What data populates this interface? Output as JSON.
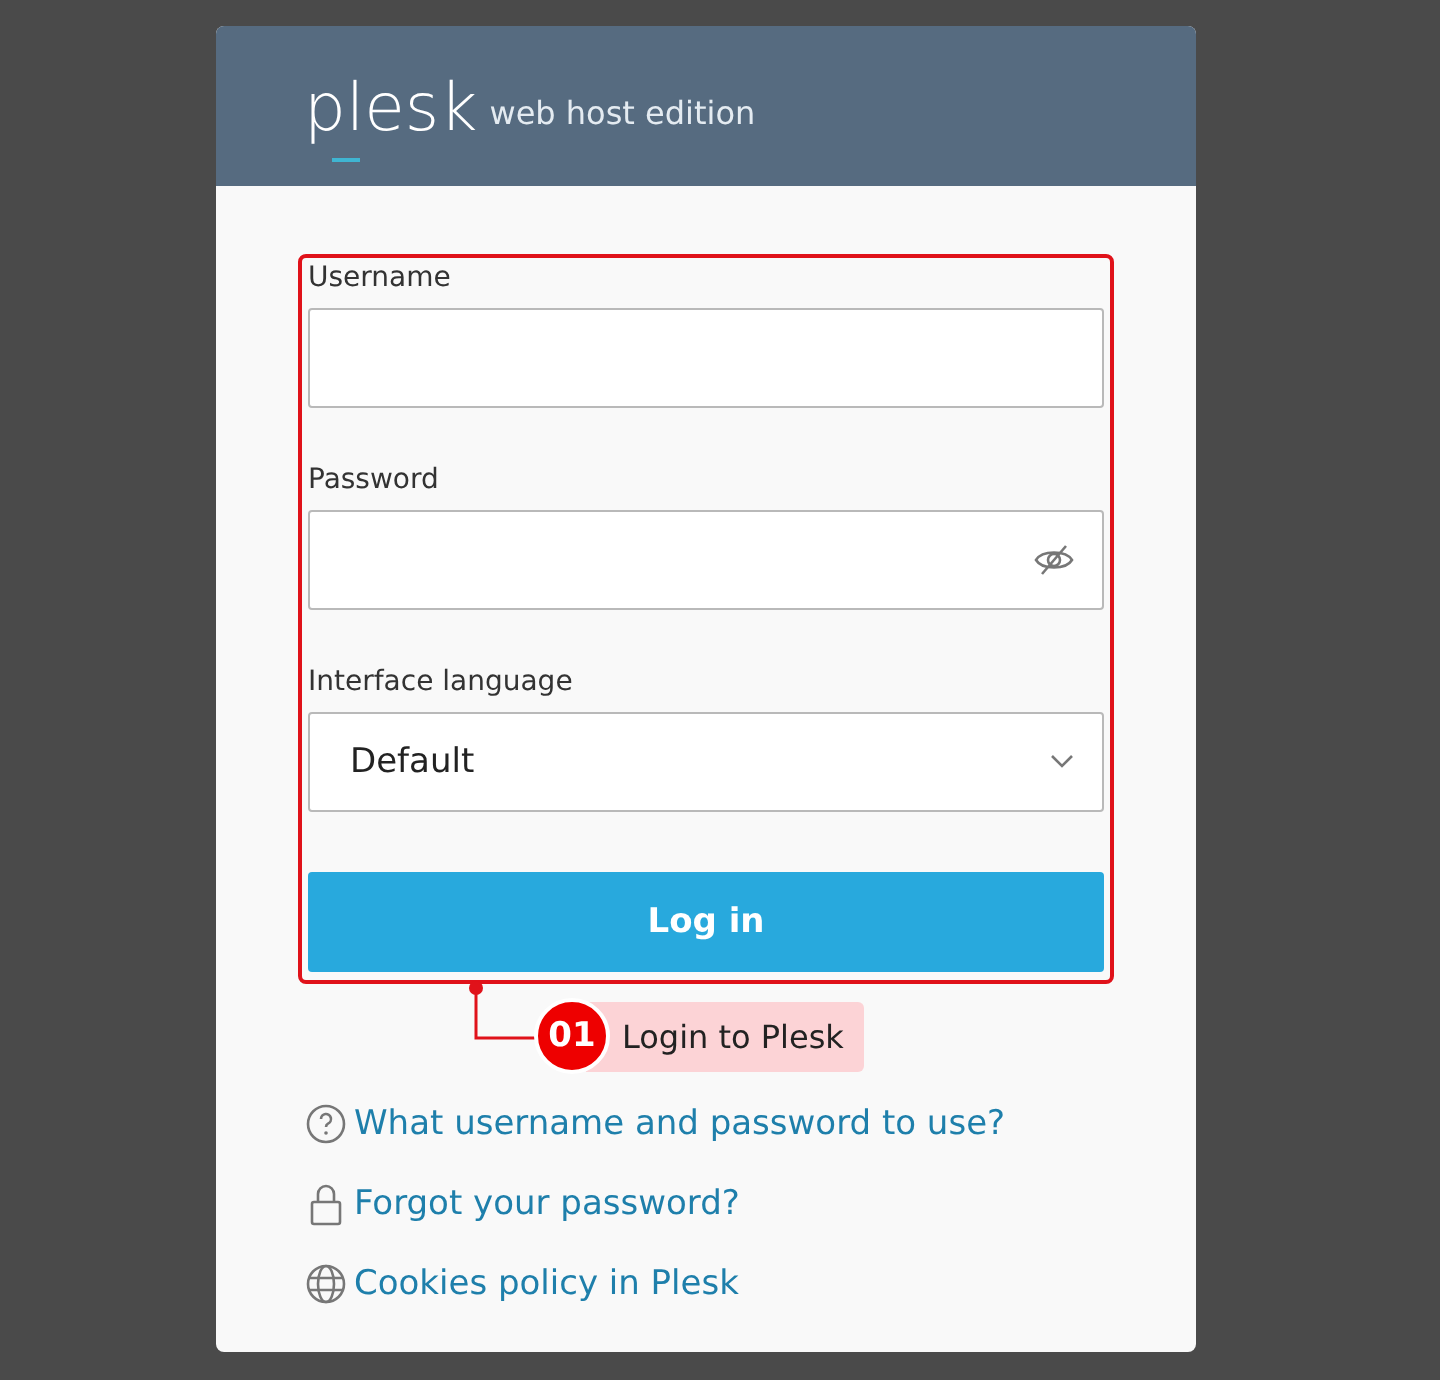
{
  "header": {
    "logo": "plesk",
    "edition": "web host edition"
  },
  "form": {
    "fields": [
      {
        "kind": "text",
        "label": "Username"
      },
      {
        "kind": "password",
        "label": "Password"
      },
      {
        "kind": "select",
        "label": "Interface language",
        "value": "Default"
      }
    ],
    "submit": "Log in"
  },
  "annotation": {
    "number": "01",
    "text": "Login to Plesk"
  },
  "links": [
    {
      "kind": "help",
      "text": "What username and password to use?"
    },
    {
      "kind": "lock",
      "text": "Forgot your password?"
    },
    {
      "kind": "globe",
      "text": "Cookies policy in Plesk"
    }
  ]
}
